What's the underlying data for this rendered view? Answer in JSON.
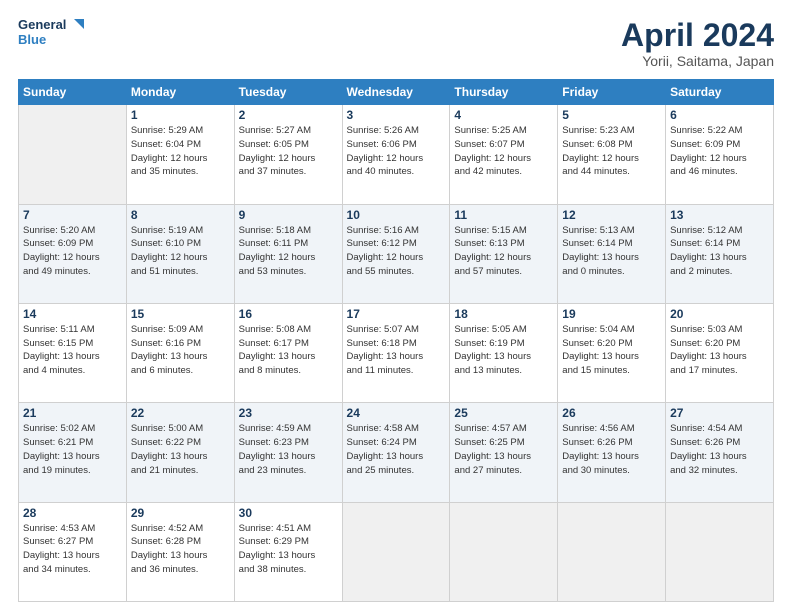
{
  "app": {
    "logo_line1": "General",
    "logo_line2": "Blue",
    "month": "April 2024",
    "location": "Yorii, Saitama, Japan"
  },
  "days_of_week": [
    "Sunday",
    "Monday",
    "Tuesday",
    "Wednesday",
    "Thursday",
    "Friday",
    "Saturday"
  ],
  "weeks": [
    [
      {
        "date": "",
        "info": ""
      },
      {
        "date": "1",
        "info": "Sunrise: 5:29 AM\nSunset: 6:04 PM\nDaylight: 12 hours\nand 35 minutes."
      },
      {
        "date": "2",
        "info": "Sunrise: 5:27 AM\nSunset: 6:05 PM\nDaylight: 12 hours\nand 37 minutes."
      },
      {
        "date": "3",
        "info": "Sunrise: 5:26 AM\nSunset: 6:06 PM\nDaylight: 12 hours\nand 40 minutes."
      },
      {
        "date": "4",
        "info": "Sunrise: 5:25 AM\nSunset: 6:07 PM\nDaylight: 12 hours\nand 42 minutes."
      },
      {
        "date": "5",
        "info": "Sunrise: 5:23 AM\nSunset: 6:08 PM\nDaylight: 12 hours\nand 44 minutes."
      },
      {
        "date": "6",
        "info": "Sunrise: 5:22 AM\nSunset: 6:09 PM\nDaylight: 12 hours\nand 46 minutes."
      }
    ],
    [
      {
        "date": "7",
        "info": "Sunrise: 5:20 AM\nSunset: 6:09 PM\nDaylight: 12 hours\nand 49 minutes."
      },
      {
        "date": "8",
        "info": "Sunrise: 5:19 AM\nSunset: 6:10 PM\nDaylight: 12 hours\nand 51 minutes."
      },
      {
        "date": "9",
        "info": "Sunrise: 5:18 AM\nSunset: 6:11 PM\nDaylight: 12 hours\nand 53 minutes."
      },
      {
        "date": "10",
        "info": "Sunrise: 5:16 AM\nSunset: 6:12 PM\nDaylight: 12 hours\nand 55 minutes."
      },
      {
        "date": "11",
        "info": "Sunrise: 5:15 AM\nSunset: 6:13 PM\nDaylight: 12 hours\nand 57 minutes."
      },
      {
        "date": "12",
        "info": "Sunrise: 5:13 AM\nSunset: 6:14 PM\nDaylight: 13 hours\nand 0 minutes."
      },
      {
        "date": "13",
        "info": "Sunrise: 5:12 AM\nSunset: 6:14 PM\nDaylight: 13 hours\nand 2 minutes."
      }
    ],
    [
      {
        "date": "14",
        "info": "Sunrise: 5:11 AM\nSunset: 6:15 PM\nDaylight: 13 hours\nand 4 minutes."
      },
      {
        "date": "15",
        "info": "Sunrise: 5:09 AM\nSunset: 6:16 PM\nDaylight: 13 hours\nand 6 minutes."
      },
      {
        "date": "16",
        "info": "Sunrise: 5:08 AM\nSunset: 6:17 PM\nDaylight: 13 hours\nand 8 minutes."
      },
      {
        "date": "17",
        "info": "Sunrise: 5:07 AM\nSunset: 6:18 PM\nDaylight: 13 hours\nand 11 minutes."
      },
      {
        "date": "18",
        "info": "Sunrise: 5:05 AM\nSunset: 6:19 PM\nDaylight: 13 hours\nand 13 minutes."
      },
      {
        "date": "19",
        "info": "Sunrise: 5:04 AM\nSunset: 6:20 PM\nDaylight: 13 hours\nand 15 minutes."
      },
      {
        "date": "20",
        "info": "Sunrise: 5:03 AM\nSunset: 6:20 PM\nDaylight: 13 hours\nand 17 minutes."
      }
    ],
    [
      {
        "date": "21",
        "info": "Sunrise: 5:02 AM\nSunset: 6:21 PM\nDaylight: 13 hours\nand 19 minutes."
      },
      {
        "date": "22",
        "info": "Sunrise: 5:00 AM\nSunset: 6:22 PM\nDaylight: 13 hours\nand 21 minutes."
      },
      {
        "date": "23",
        "info": "Sunrise: 4:59 AM\nSunset: 6:23 PM\nDaylight: 13 hours\nand 23 minutes."
      },
      {
        "date": "24",
        "info": "Sunrise: 4:58 AM\nSunset: 6:24 PM\nDaylight: 13 hours\nand 25 minutes."
      },
      {
        "date": "25",
        "info": "Sunrise: 4:57 AM\nSunset: 6:25 PM\nDaylight: 13 hours\nand 27 minutes."
      },
      {
        "date": "26",
        "info": "Sunrise: 4:56 AM\nSunset: 6:26 PM\nDaylight: 13 hours\nand 30 minutes."
      },
      {
        "date": "27",
        "info": "Sunrise: 4:54 AM\nSunset: 6:26 PM\nDaylight: 13 hours\nand 32 minutes."
      }
    ],
    [
      {
        "date": "28",
        "info": "Sunrise: 4:53 AM\nSunset: 6:27 PM\nDaylight: 13 hours\nand 34 minutes."
      },
      {
        "date": "29",
        "info": "Sunrise: 4:52 AM\nSunset: 6:28 PM\nDaylight: 13 hours\nand 36 minutes."
      },
      {
        "date": "30",
        "info": "Sunrise: 4:51 AM\nSunset: 6:29 PM\nDaylight: 13 hours\nand 38 minutes."
      },
      {
        "date": "",
        "info": ""
      },
      {
        "date": "",
        "info": ""
      },
      {
        "date": "",
        "info": ""
      },
      {
        "date": "",
        "info": ""
      }
    ]
  ]
}
